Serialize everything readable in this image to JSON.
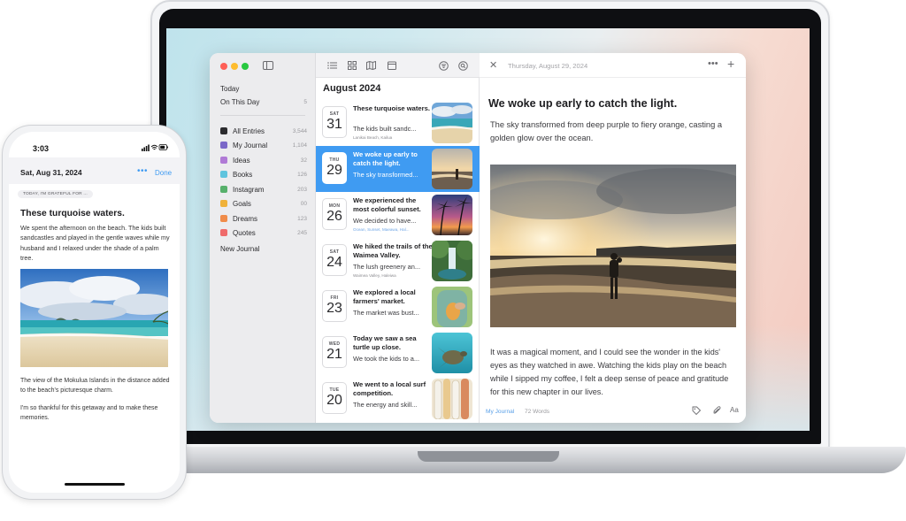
{
  "sidebar": {
    "items_top": [
      {
        "label": "Today",
        "count": ""
      },
      {
        "label": "On This Day",
        "count": "5"
      }
    ],
    "journals": [
      {
        "label": "All Entries",
        "count": "3,544",
        "color": "#2b2b2e"
      },
      {
        "label": "My Journal",
        "count": "1,104",
        "color": "#7b68c8"
      },
      {
        "label": "Ideas",
        "count": "32",
        "color": "#b07ad6"
      },
      {
        "label": "Books",
        "count": "126",
        "color": "#5fc4de"
      },
      {
        "label": "Instagram",
        "count": "203",
        "color": "#57b06b"
      },
      {
        "label": "Goals",
        "count": "00",
        "color": "#f0b23a"
      },
      {
        "label": "Dreams",
        "count": "123",
        "color": "#f08c4a"
      },
      {
        "label": "Quotes",
        "count": "245",
        "color": "#ef6b6b"
      }
    ],
    "new_journal": "New Journal"
  },
  "list": {
    "month": "August 2024",
    "entries": [
      {
        "dow": "SAT",
        "day": "31",
        "title": "These turquoise waters.",
        "snippet": "The kids built sandc...",
        "meta": "Lanikai Beach, Kailua",
        "thumb": "beach-sky"
      },
      {
        "dow": "THU",
        "day": "29",
        "title": "We woke up early to catch the light.",
        "snippet": "The sky transformed...",
        "meta": "",
        "thumb": "sunset-beach"
      },
      {
        "dow": "MON",
        "day": "26",
        "title": "We experienced the most colorful sunset.",
        "snippet": "We decided to have...",
        "meta": "Ocean, Sunset,  Maeawa, Hal...",
        "thumb": "palm-sunset"
      },
      {
        "dow": "SAT",
        "day": "24",
        "title": "We hiked the  trails of the Waimea Valley.",
        "snippet": "The lush greenery an...",
        "meta": "Waimea Valley, Haleiwa",
        "thumb": "waterfall"
      },
      {
        "dow": "FRI",
        "day": "23",
        "title": "We explored a local farmers' market.",
        "snippet": "The market was bust...",
        "meta": "",
        "thumb": "market"
      },
      {
        "dow": "WED",
        "day": "21",
        "title": "Today we saw a sea turtle up close.",
        "snippet": "We took the kids to a...",
        "meta": "",
        "thumb": "turtle"
      },
      {
        "dow": "TUE",
        "day": "20",
        "title": "We went to a local surf competition.",
        "snippet": "The energy and skill...",
        "meta": "",
        "thumb": "surfboards"
      }
    ]
  },
  "detail": {
    "date": "Thursday, August 29, 2024",
    "title": "We woke up early to catch the light.",
    "para1": "The sky transformed from deep purple to fiery orange, casting a golden glow over the ocean.",
    "para2": "It was a magical moment, and I could see the wonder in the kids' eyes as they watched in awe. Watching the kids play on the beach while I sipped my coffee, I felt a deep sense of peace and gratitude for this new chapter in our lives.",
    "journal": "My Journal",
    "words": "72 Words",
    "format_label": "Aa"
  },
  "phone": {
    "time": "3:03",
    "date": "Sat, Aug 31, 2024",
    "done": "Done",
    "prompt": "TODAY, I'M GRATEFUL FOR ...",
    "title": "These turquoise waters.",
    "body1": "We spent the afternoon on the beach. The kids built sandcastles and played in the gentle waves while my husband and I relaxed under the shade of a palm tree.",
    "body2": "The view of the Mokulua Islands in the distance added to the beach's picturesque charm.",
    "body3": "I'm so thankful for this getaway and to make these memories."
  },
  "colors": {
    "accent": "#3f9bf2",
    "selected_row": "#3f9bf2"
  }
}
